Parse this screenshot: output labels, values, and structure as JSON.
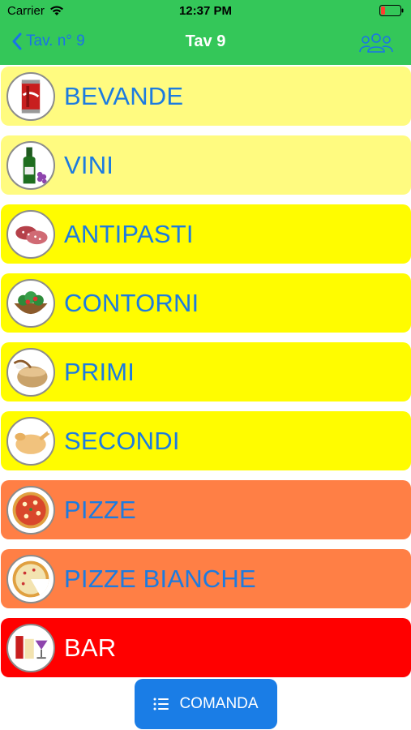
{
  "status_bar": {
    "carrier": "Carrier",
    "time": "12:37 PM"
  },
  "nav": {
    "back_label": "Tav. n° 9",
    "title": "Tav 9",
    "right_icon": "people-group-icon"
  },
  "categories": [
    {
      "label": "BEVANDE",
      "icon": "cola-can-icon",
      "color": "#fffb80"
    },
    {
      "label": "VINI",
      "icon": "wine-bottle-icon",
      "color": "#fffb80"
    },
    {
      "label": "ANTIPASTI",
      "icon": "salami-icon",
      "color": "#fffc00"
    },
    {
      "label": "CONTORNI",
      "icon": "salad-bowl-icon",
      "color": "#fffc00"
    },
    {
      "label": "PRIMI",
      "icon": "pasta-pot-icon",
      "color": "#fffc00"
    },
    {
      "label": "SECONDI",
      "icon": "roast-chicken-icon",
      "color": "#fffc00"
    },
    {
      "label": "PIZZE",
      "icon": "pizza-icon",
      "color": "#ff7f45"
    },
    {
      "label": "PIZZE BIANCHE",
      "icon": "pizza-slice-icon",
      "color": "#ff7f45"
    },
    {
      "label": "BAR",
      "icon": "cocktail-bar-icon",
      "color": "#ff0000"
    }
  ],
  "comanda_button": {
    "label": "COMANDA",
    "icon": "list-icon"
  },
  "colors": {
    "header": "#34c759",
    "accent": "#1a7de6"
  }
}
